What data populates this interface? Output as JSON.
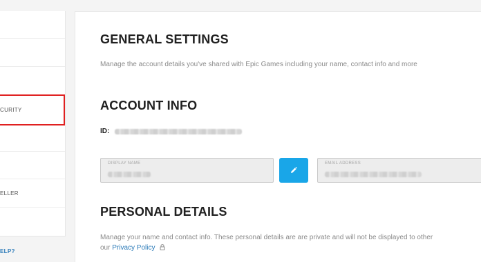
{
  "sidebar": {
    "items": [
      {
        "label": ""
      },
      {
        "label": ""
      },
      {
        "label": "CURITY"
      },
      {
        "label": ""
      },
      {
        "label": ""
      },
      {
        "label": "ELLER"
      },
      {
        "label": ""
      }
    ],
    "help_label": "ELP?"
  },
  "general": {
    "title": "GENERAL SETTINGS",
    "description": "Manage the account details you've shared with Epic Games including your name, contact info and more"
  },
  "account_info": {
    "title": "ACCOUNT INFO",
    "id_label": "ID:",
    "display_name_label": "DISPLAY NAME",
    "email_label": "EMAIL ADDRESS"
  },
  "personal": {
    "title": "PERSONAL DETAILS",
    "description": "Manage your name and contact info. These personal details are are private and will not be displayed to other",
    "description_prefix": "our",
    "privacy_link": "Privacy Policy"
  },
  "colors": {
    "accent": "#19a6e8",
    "selected_border": "#e02020",
    "link": "#2a7ab8"
  },
  "icons": {
    "edit": "pencil-icon",
    "lock": "lock-icon"
  }
}
